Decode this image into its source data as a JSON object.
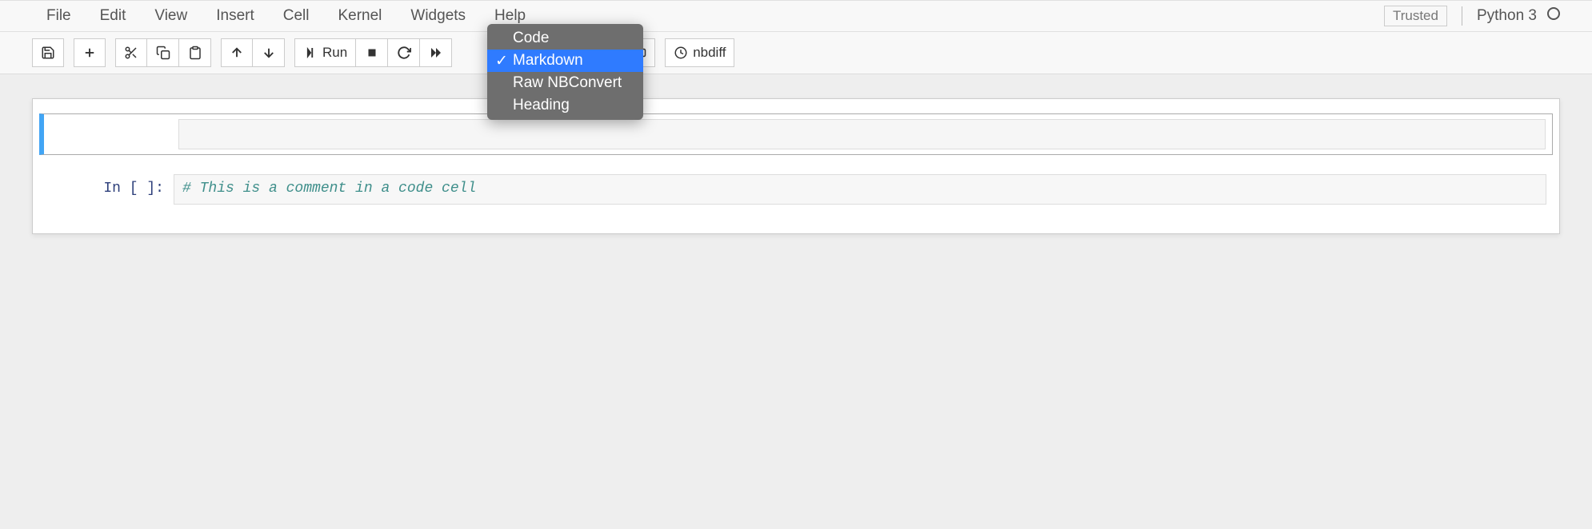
{
  "menu": {
    "file": "File",
    "edit": "Edit",
    "view": "View",
    "insert": "Insert",
    "cell": "Cell",
    "kernel": "Kernel",
    "widgets": "Widgets",
    "help": "Help"
  },
  "header": {
    "trusted": "Trusted",
    "kernel": "Python 3"
  },
  "toolbar": {
    "run": "Run",
    "nbdiff": "nbdiff"
  },
  "celltype_dropdown": {
    "options": {
      "code": "Code",
      "markdown": "Markdown",
      "raw": "Raw NBConvert",
      "heading": "Heading"
    },
    "selected": "markdown"
  },
  "cells": {
    "c0": {
      "prompt": "",
      "source": ""
    },
    "c1": {
      "prompt": "In [ ]:",
      "source": "# This is a comment in a code cell"
    }
  }
}
